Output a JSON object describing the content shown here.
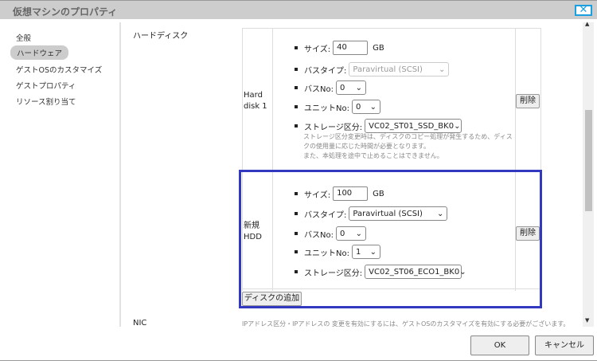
{
  "window": {
    "title": "仮想マシンのプロパティ"
  },
  "sidebar": {
    "items": [
      {
        "label": "全般"
      },
      {
        "label": "ハードウェア"
      },
      {
        "label": "ゲストOSのカスタマイズ"
      },
      {
        "label": "ゲストプロパティ"
      },
      {
        "label": "リソース割り当て"
      }
    ]
  },
  "harddisk": {
    "section_label": "ハードディスク",
    "disks": [
      {
        "name": "Hard disk 1",
        "size_label": "サイズ:",
        "size": "40",
        "unit": "GB",
        "bus_type_label": "バスタイプ:",
        "bus_type": "Paravirtual (SCSI)",
        "bus_no_label": "バスNo:",
        "bus_no": "0",
        "unit_no_label": "ユニットNo:",
        "unit_no": "0",
        "storage_label": "ストレージ区分:",
        "storage": "VC02_ST01_SSD_BK0",
        "note": "ストレージ区分変更時は、ディスクのコピー処理が発生するため、ディスクの使用量に応じた時間が必要となります。",
        "note2": "また、本処理を途中で止めることはできません。",
        "delete_label": "削除"
      },
      {
        "name": "新規HDD",
        "size_label": "サイズ:",
        "size": "100",
        "unit": "GB",
        "bus_type_label": "バスタイプ:",
        "bus_type": "Paravirtual (SCSI)",
        "bus_no_label": "バスNo:",
        "bus_no": "0",
        "unit_no_label": "ユニットNo:",
        "unit_no": "1",
        "storage_label": "ストレージ区分:",
        "storage": "VC02_ST06_ECO1_BK0",
        "delete_label": "削除"
      }
    ],
    "add_disk_label": "ディスクの追加"
  },
  "nic": {
    "label": "NIC",
    "note": "IPアドレス区分・IPアドレスの 変更を有効にするには、ゲストOSのカスタマイズを有効にする必要がございます。"
  },
  "footer": {
    "ok": "OK",
    "cancel": "キャンセル"
  }
}
